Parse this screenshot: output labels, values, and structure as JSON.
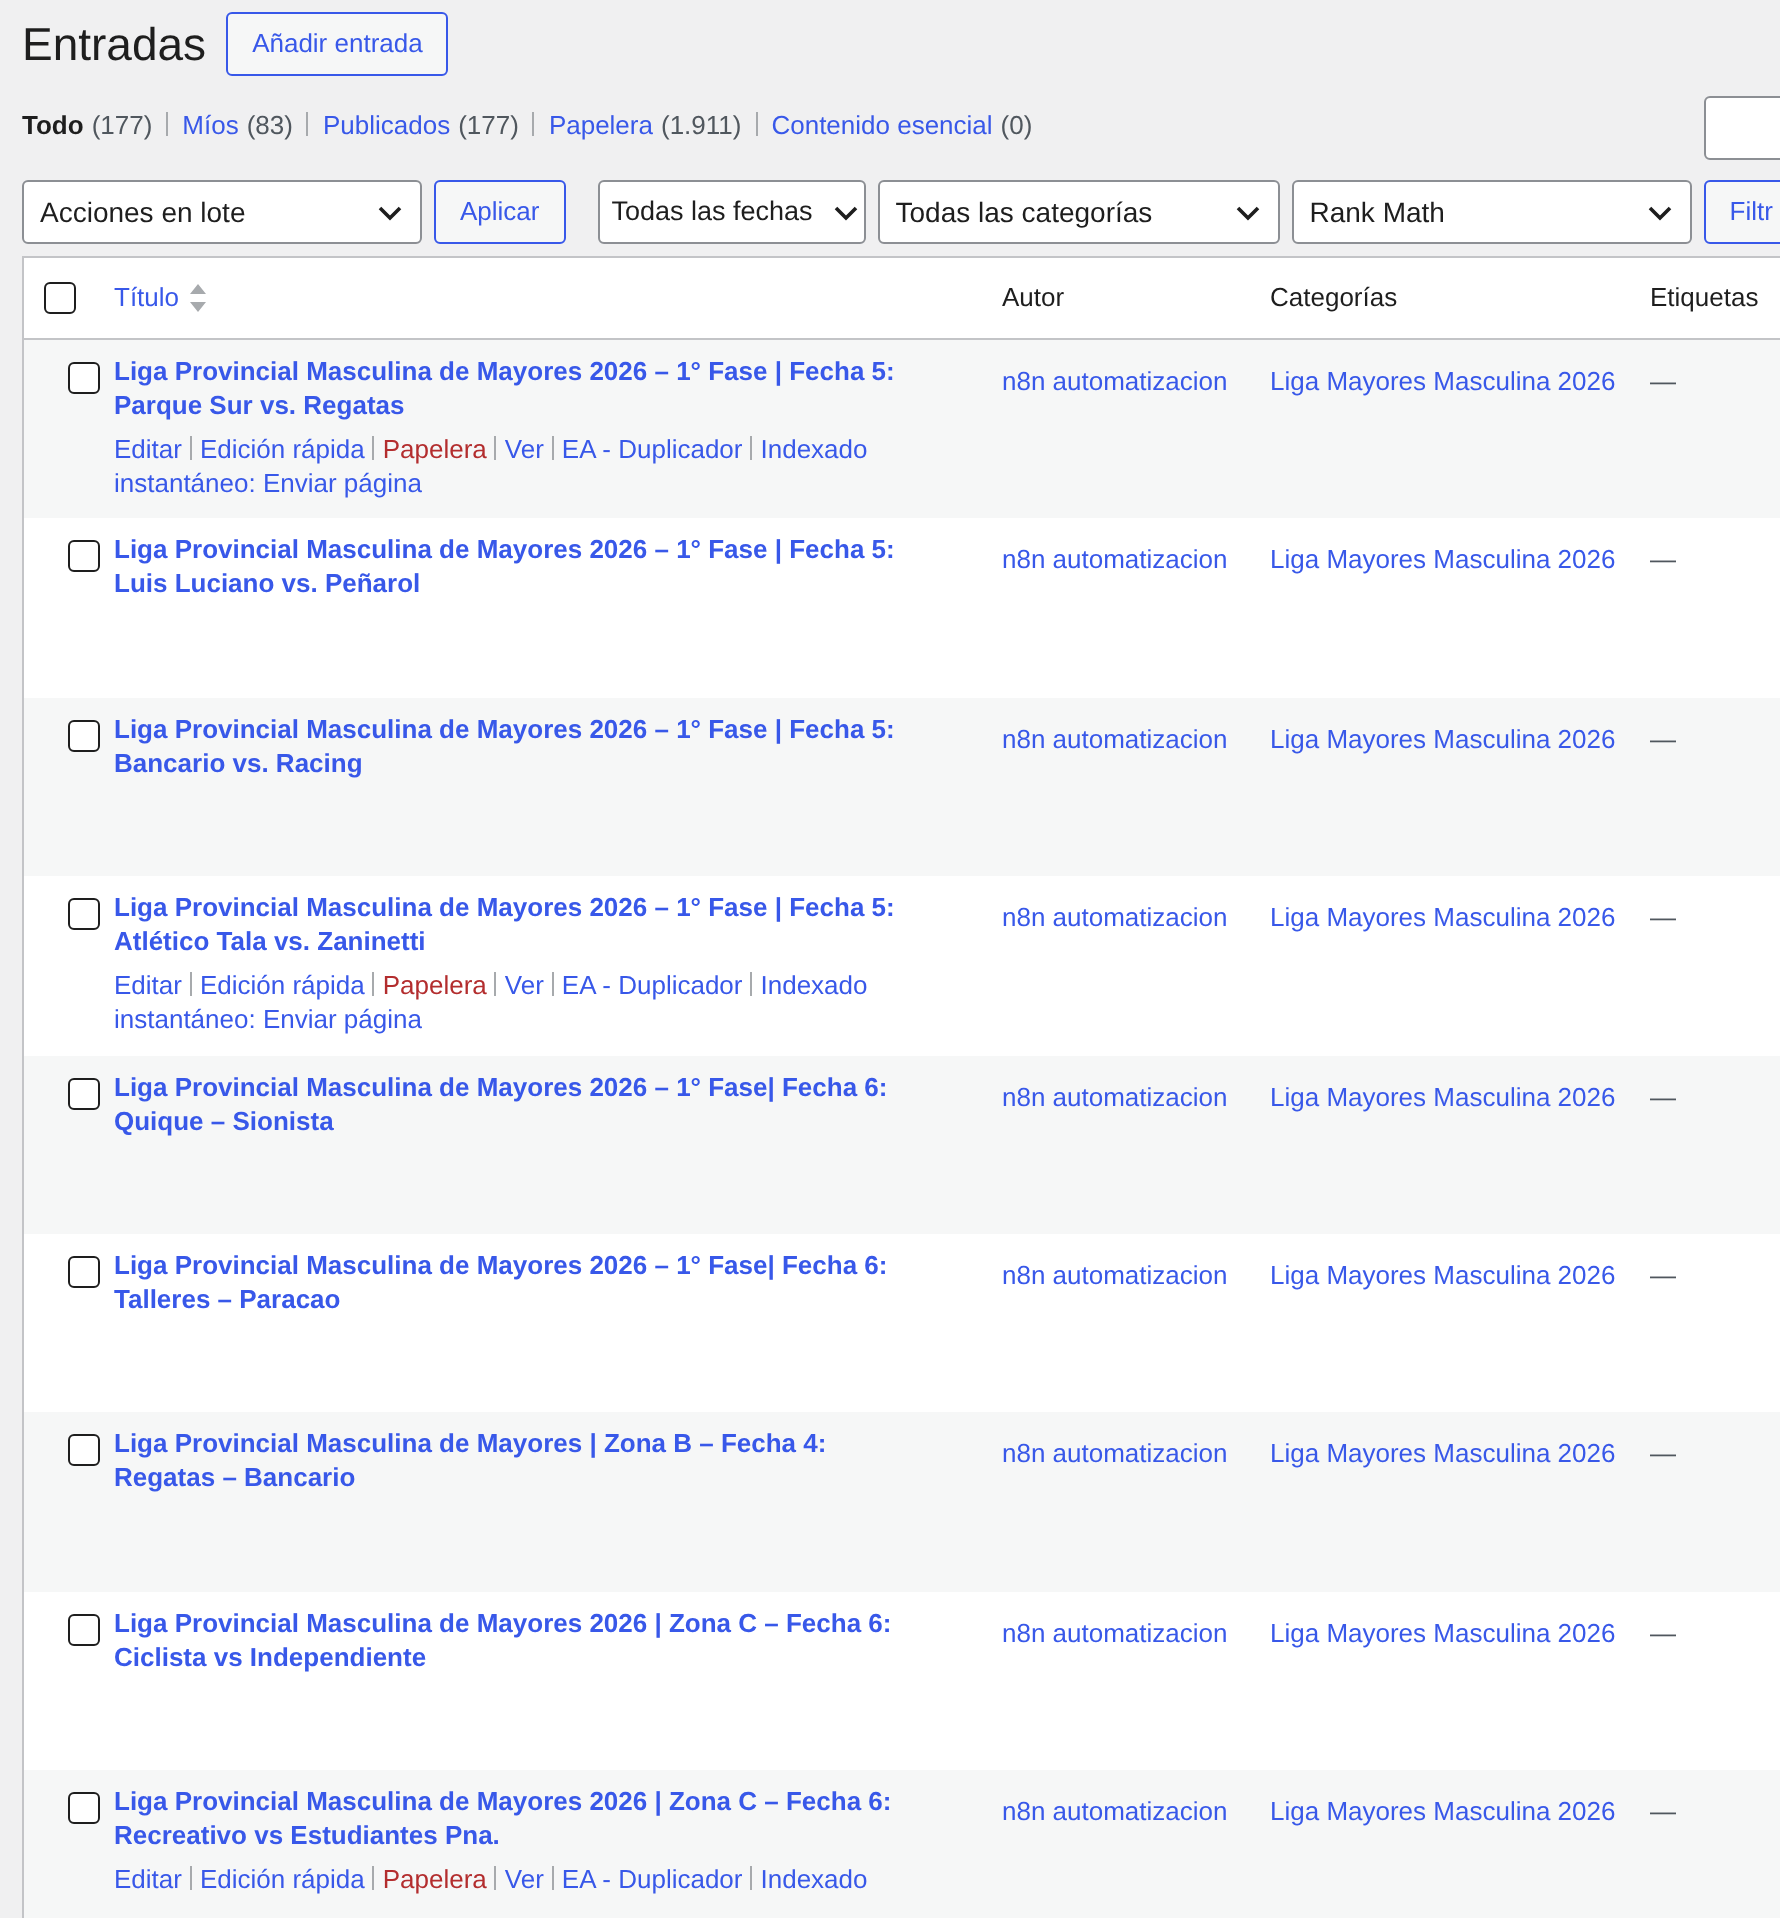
{
  "page_title": "Entradas",
  "add_button": "Añadir entrada",
  "views": [
    {
      "label": "Todo",
      "count": "(177)",
      "selected": true
    },
    {
      "label": "Míos",
      "count": "(83)",
      "selected": false
    },
    {
      "label": "Publicados",
      "count": "(177)",
      "selected": false
    },
    {
      "label": "Papelera",
      "count": "(1.911)",
      "selected": false
    },
    {
      "label": "Contenido esencial",
      "count": "(0)",
      "selected": false
    }
  ],
  "bulk_select": "Acciones en lote",
  "apply_button": "Aplicar",
  "filters": [
    "Todas las fechas",
    "Todas las categorías",
    "Rank Math"
  ],
  "filter_button": "Filtr",
  "table": {
    "select_all_checked": false,
    "columns": [
      "Título",
      "Autor",
      "Categorías",
      "Etiquetas"
    ],
    "rows": [
      {
        "title": "Liga Provincial Masculina de Mayores 2026 – 1° Fase | Fecha 5: Parque Sur vs. Regatas",
        "author": "n8n automatizacion",
        "category": "Liga Mayores Masculina 2026",
        "tags": "—",
        "checked": false,
        "actions": [
          {
            "label": "Editar",
            "kind": "link"
          },
          {
            "label": "Edición rápida",
            "kind": "link"
          },
          {
            "label": "Papelera",
            "kind": "danger"
          },
          {
            "label": "Ver",
            "kind": "link"
          },
          {
            "label": "EA - Duplicador",
            "kind": "link"
          },
          {
            "label": "Indexado instantáneo: Enviar página",
            "kind": "link"
          }
        ]
      },
      {
        "title": "Liga Provincial Masculina de Mayores 2026 – 1° Fase | Fecha 5: Luis Luciano vs. Peñarol",
        "author": "n8n automatizacion",
        "category": "Liga Mayores Masculina 2026",
        "tags": "—",
        "checked": false
      },
      {
        "title": "Liga Provincial Masculina de Mayores 2026 – 1° Fase | Fecha 5: Bancario vs. Racing",
        "author": "n8n automatizacion",
        "category": "Liga Mayores Masculina 2026",
        "tags": "—",
        "checked": false
      },
      {
        "title": "Liga Provincial Masculina de Mayores 2026 – 1° Fase | Fecha 5: Atlético Tala vs. Zaninetti",
        "author": "n8n automatizacion",
        "category": "Liga Mayores Masculina 2026",
        "tags": "—",
        "checked": false,
        "actions": [
          {
            "label": "Editar",
            "kind": "link"
          },
          {
            "label": "Edición rápida",
            "kind": "link"
          },
          {
            "label": "Papelera",
            "kind": "danger"
          },
          {
            "label": "Ver",
            "kind": "link"
          },
          {
            "label": "EA - Duplicador",
            "kind": "link"
          },
          {
            "label": "Indexado instantáneo: Enviar página",
            "kind": "link"
          }
        ]
      },
      {
        "title": "Liga Provincial Masculina de Mayores 2026 – 1° Fase| Fecha 6: Quique – Sionista",
        "author": "n8n automatizacion",
        "category": "Liga Mayores Masculina 2026",
        "tags": "—",
        "checked": false
      },
      {
        "title": "Liga Provincial Masculina de Mayores 2026 – 1° Fase| Fecha 6: Talleres – Paracao",
        "author": "n8n automatizacion",
        "category": "Liga Mayores Masculina 2026",
        "tags": "—",
        "checked": false
      },
      {
        "title": "Liga Provincial Masculina de Mayores | Zona B – Fecha 4: Regatas – Bancario",
        "author": "n8n automatizacion",
        "category": "Liga Mayores Masculina 2026",
        "tags": "—",
        "checked": false
      },
      {
        "title": "Liga Provincial Masculina de Mayores 2026 | Zona C – Fecha 6: Ciclista vs Independiente",
        "author": "n8n automatizacion",
        "category": "Liga Mayores Masculina 2026",
        "tags": "—",
        "checked": false
      },
      {
        "title": "Liga Provincial Masculina de Mayores 2026 | Zona C – Fecha 6: Recreativo vs Estudiantes Pna.",
        "author": "n8n automatizacion",
        "category": "Liga Mayores Masculina 2026",
        "tags": "—",
        "checked": false,
        "actions": [
          {
            "label": "Editar",
            "kind": "link"
          },
          {
            "label": "Edición rápida",
            "kind": "link"
          },
          {
            "label": "Papelera",
            "kind": "danger"
          },
          {
            "label": "Ver",
            "kind": "link"
          },
          {
            "label": "EA - Duplicador",
            "kind": "link"
          },
          {
            "label": "Indexado",
            "kind": "link"
          }
        ]
      }
    ]
  }
}
